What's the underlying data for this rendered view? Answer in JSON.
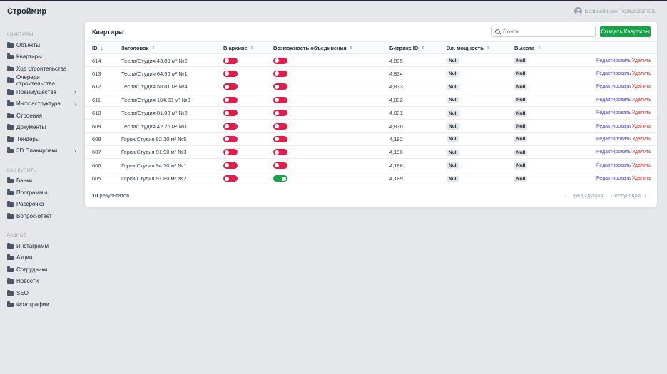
{
  "app": {
    "brand": "Строймир",
    "user_name": "Безымянный пользователь"
  },
  "sidebar": {
    "sections": [
      {
        "label": "КВАРТИРЫ"
      },
      {
        "label": "КАК КУПИТЬ"
      },
      {
        "label": "РАЗНОЕ"
      }
    ],
    "items": [
      {
        "label": "Объекты"
      },
      {
        "label": "Квартиры"
      },
      {
        "label": "Ход строительства"
      },
      {
        "label": "Очереди строительства"
      },
      {
        "label": "Преимущества",
        "chevron": "›"
      },
      {
        "label": "Инфраструктура",
        "chevron": "›"
      },
      {
        "label": "Строения"
      },
      {
        "label": "Документы"
      },
      {
        "label": "Тендеры"
      },
      {
        "label": "3D Планировки",
        "chevron": "›"
      },
      {
        "label": "Банки"
      },
      {
        "label": "Программы"
      },
      {
        "label": "Рассрочка"
      },
      {
        "label": "Вопрос-ответ"
      },
      {
        "label": "Инстаграмм"
      },
      {
        "label": "Акции"
      },
      {
        "label": "Сотрудники"
      },
      {
        "label": "Новости"
      },
      {
        "label": "SEO"
      },
      {
        "label": "Фотографии"
      }
    ]
  },
  "card": {
    "title": "Квартиры",
    "search_placeholder": "Поиск",
    "create_label": "Создать Квартиры"
  },
  "table": {
    "columns": [
      {
        "label": "ID",
        "sort": "↓"
      },
      {
        "label": "Заголовок",
        "sort": "⇕"
      },
      {
        "label": "В архиве",
        "sort": "⇕"
      },
      {
        "label": "Возможность объединения",
        "sort": "⇕"
      },
      {
        "label": "Битрикс ID",
        "sort": "⇕"
      },
      {
        "label": "Эл. мощность",
        "sort": "⇕"
      },
      {
        "label": "Высота",
        "sort": "⇕"
      }
    ],
    "edit_label": "Редактировать",
    "delete_label": "Удалить",
    "rows": [
      {
        "id": "614",
        "title": "Тесла/Студия 43.00 м² №2",
        "archived": false,
        "mergeable": false,
        "bitrix_id": "4,835",
        "power": "Null",
        "height": "Null"
      },
      {
        "id": "613",
        "title": "Тесла/Студия 64.56 м² №1",
        "archived": false,
        "mergeable": false,
        "bitrix_id": "4,834",
        "power": "Null",
        "height": "Null"
      },
      {
        "id": "612",
        "title": "Тесла/Студия 58.01 м² №4",
        "archived": false,
        "mergeable": false,
        "bitrix_id": "4,833",
        "power": "Null",
        "height": "Null"
      },
      {
        "id": "611",
        "title": "Тесла/Студия 104.23 м² №3",
        "archived": false,
        "mergeable": false,
        "bitrix_id": "4,832",
        "power": "Null",
        "height": "Null"
      },
      {
        "id": "610",
        "title": "Тесла/Студия 81.08 м² №2",
        "archived": false,
        "mergeable": false,
        "bitrix_id": "4,831",
        "power": "Null",
        "height": "Null"
      },
      {
        "id": "609",
        "title": "Тесла/Студия 42.26 м² №1",
        "archived": false,
        "mergeable": false,
        "bitrix_id": "4,830",
        "power": "Null",
        "height": "Null"
      },
      {
        "id": "608",
        "title": "Горки/Студия 82.10 м² №5",
        "archived": false,
        "mergeable": false,
        "bitrix_id": "4,192",
        "power": "Null",
        "height": "Null"
      },
      {
        "id": "607",
        "title": "Горки/Студия 91.90 м² №3",
        "archived": false,
        "mergeable": false,
        "bitrix_id": "4,190",
        "power": "Null",
        "height": "Null"
      },
      {
        "id": "606",
        "title": "Горки/Студия 94.70 м² №1",
        "archived": false,
        "mergeable": false,
        "bitrix_id": "4,188",
        "power": "Null",
        "height": "Null"
      },
      {
        "id": "605",
        "title": "Горки/Студия 91.80 м² №2",
        "archived": false,
        "mergeable": true,
        "bitrix_id": "4,189",
        "power": "Null",
        "height": "Null"
      }
    ]
  },
  "footer": {
    "count": "10",
    "count_suffix": " результатов",
    "prev_label": "Предыдущая",
    "next_label": "Следующая",
    "prev_icon": "‹",
    "next_icon": "›"
  },
  "colors": {
    "accent_green": "#16a34a",
    "toggle_off": "#e11d48",
    "edit_link": "#4f46e5",
    "delete_link": "#dc2626"
  }
}
